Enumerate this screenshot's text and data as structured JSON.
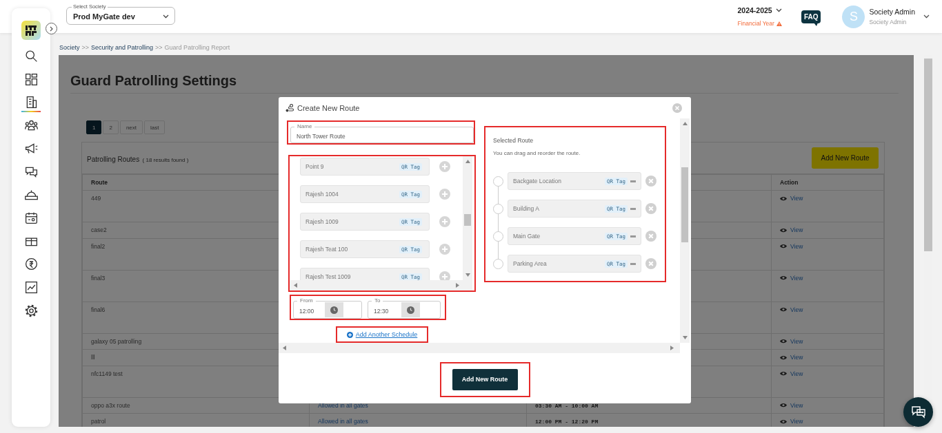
{
  "header": {
    "society_select": {
      "label": "Select Society",
      "value": "Prod MyGate dev"
    },
    "financial_year": {
      "value": "2024-2025",
      "label": "Financial Year",
      "warning": true
    },
    "faq": "FAQ",
    "user": {
      "initial": "S",
      "name": "Society Admin",
      "role": "Society Admin"
    }
  },
  "sidebar": {
    "items": [
      {
        "selected": false
      },
      {
        "selected": false
      },
      {
        "selected": true
      },
      {
        "selected": false
      },
      {
        "selected": false
      },
      {
        "selected": false
      },
      {
        "selected": false
      },
      {
        "selected": false
      },
      {
        "selected": false
      },
      {
        "selected": false
      },
      {
        "selected": false
      },
      {
        "selected": false
      }
    ]
  },
  "breadcrumb": {
    "separator": ">>",
    "items": [
      {
        "label": "Society"
      },
      {
        "label": "Security and Patrolling"
      },
      {
        "label": "Guard Patrolling Report"
      }
    ]
  },
  "page": {
    "title": "Guard Patrolling Settings",
    "pagination": [
      {
        "label": "1",
        "selected": true
      },
      {
        "label": "2",
        "selected": false
      },
      {
        "label": "next",
        "selected": false
      },
      {
        "label": "last",
        "selected": false
      }
    ],
    "routes_card": {
      "title": "Patrolling Routes",
      "count": "( 18 results found )",
      "add_button": "Add New Route"
    },
    "table": {
      "columns": [
        {
          "label": "Route"
        },
        {
          "label": "Action"
        }
      ],
      "rows": [
        {
          "kind": "multi-line",
          "route": "449",
          "action": "View"
        },
        {
          "kind": "single-line",
          "route": "case2",
          "action": "View"
        },
        {
          "kind": "multi-line",
          "route": "final2",
          "action": "View"
        },
        {
          "kind": "multi-line",
          "route": "final3",
          "action": "View"
        },
        {
          "kind": "multi-line",
          "route": "final6",
          "action": "View"
        },
        {
          "kind": "single-line",
          "route": "galaxy 05 patrolling",
          "action": "View"
        },
        {
          "kind": "single-line",
          "route": "lll",
          "action": "View"
        },
        {
          "kind": "multi-line",
          "route": "nfc1149 test",
          "action": "View"
        },
        {
          "kind": "single-line",
          "route": "oppo a3x route",
          "column_2": "Allowed in all gates",
          "column_3": "03:30 AM - 10:00 AM",
          "action": "View"
        },
        {
          "kind": "single-line",
          "route": "patrol",
          "column_2": "Allowed in all gates",
          "column_3": "12:00 PM - 12:20 PM",
          "action": "View"
        }
      ]
    }
  },
  "modal": {
    "title": "Create New Route",
    "name_field": {
      "label": "Name",
      "value": "North Tower Route",
      "highlighted": true
    },
    "points": {
      "highlighted": true,
      "items": [
        {
          "name": "Point 9",
          "tag": "QR Tag"
        },
        {
          "name": "Rajesh 1004",
          "tag": "QR Tag"
        },
        {
          "name": "Rajesh 1009",
          "tag": "QR Tag"
        },
        {
          "name": "Rajesh Teat 100",
          "tag": "QR Tag"
        },
        {
          "name": "Rajesh Test 1009",
          "tag": "QR Tag"
        }
      ]
    },
    "schedule": {
      "highlighted": true,
      "from": {
        "label": "From",
        "value": "12:00"
      },
      "to": {
        "label": "To",
        "value": "12:30"
      }
    },
    "add_schedule": {
      "label": "Add Another Schedule",
      "highlighted": true
    },
    "selected_route": {
      "highlighted": true,
      "title": "Selected Route",
      "hint": "You can drag and reorder the route.",
      "items": [
        {
          "name": "Backgate Location",
          "tag": "QR Tag"
        },
        {
          "name": "Building A",
          "tag": "QR Tag"
        },
        {
          "name": "Main Gate",
          "tag": "QR Tag"
        },
        {
          "name": "Parking Area",
          "tag": "QR Tag"
        }
      ]
    },
    "submit": {
      "label": "Add New Route",
      "highlighted": true
    }
  }
}
